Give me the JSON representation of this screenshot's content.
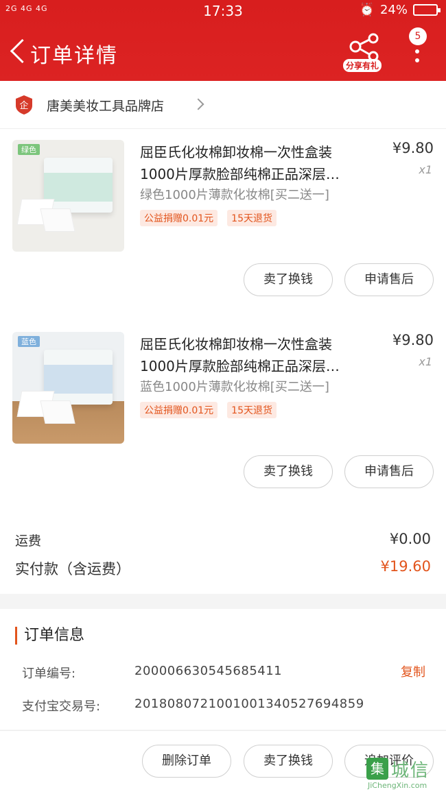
{
  "status_bar": {
    "signal_left": "2G 4G 4G",
    "time": "17:33",
    "battery": "24%"
  },
  "header": {
    "title": "订单详情",
    "share_label": "分享有礼",
    "notification_count": "5",
    "background_color": "#d81e1e"
  },
  "shop": {
    "icon_text": "企",
    "name": "唐美美妆工具品牌店"
  },
  "items": [
    {
      "tag": "绿色",
      "tag_color": "#7cc57c",
      "name": "屈臣氏化妆棉卸妆棉一次性盒装1000片厚款脸部纯棉正品深层…",
      "sku": "绿色1000片薄款化妆棉[买二送一]",
      "tags": [
        "公益捐赠0.01元",
        "15天退货"
      ],
      "price": "¥9.80",
      "qty": "x1",
      "buttons": [
        "卖了换钱",
        "申请售后"
      ],
      "band_color": "#cfe9df"
    },
    {
      "tag": "蓝色",
      "tag_color": "#7fb0dc",
      "name": "屈臣氏化妆棉卸妆棉一次性盒装1000片厚款脸部纯棉正品深层…",
      "sku": "蓝色1000片薄款化妆棉[买二送一]",
      "tags": [
        "公益捐赠0.01元",
        "15天退货"
      ],
      "price": "¥9.80",
      "qty": "x1",
      "buttons": [
        "卖了换钱",
        "申请售后"
      ],
      "band_color": "#cfe0ee"
    }
  ],
  "fees": {
    "shipping_label": "运费",
    "shipping_value": "¥0.00",
    "total_label": "实付款（含运费）",
    "total_value": "¥19.60",
    "total_color": "#e2541c"
  },
  "order_info": {
    "title": "订单信息",
    "order_no_label": "订单编号:",
    "order_no": "200006630545685411",
    "copy_label": "复制",
    "alipay_label": "支付宝交易号:",
    "alipay_no": "2018080721001001340527694859"
  },
  "footer": {
    "buttons": [
      "删除订单",
      "卖了换钱",
      "追加评价"
    ]
  },
  "watermark": {
    "box": "集",
    "text": "城信",
    "sub": "JiChengXin.com"
  }
}
